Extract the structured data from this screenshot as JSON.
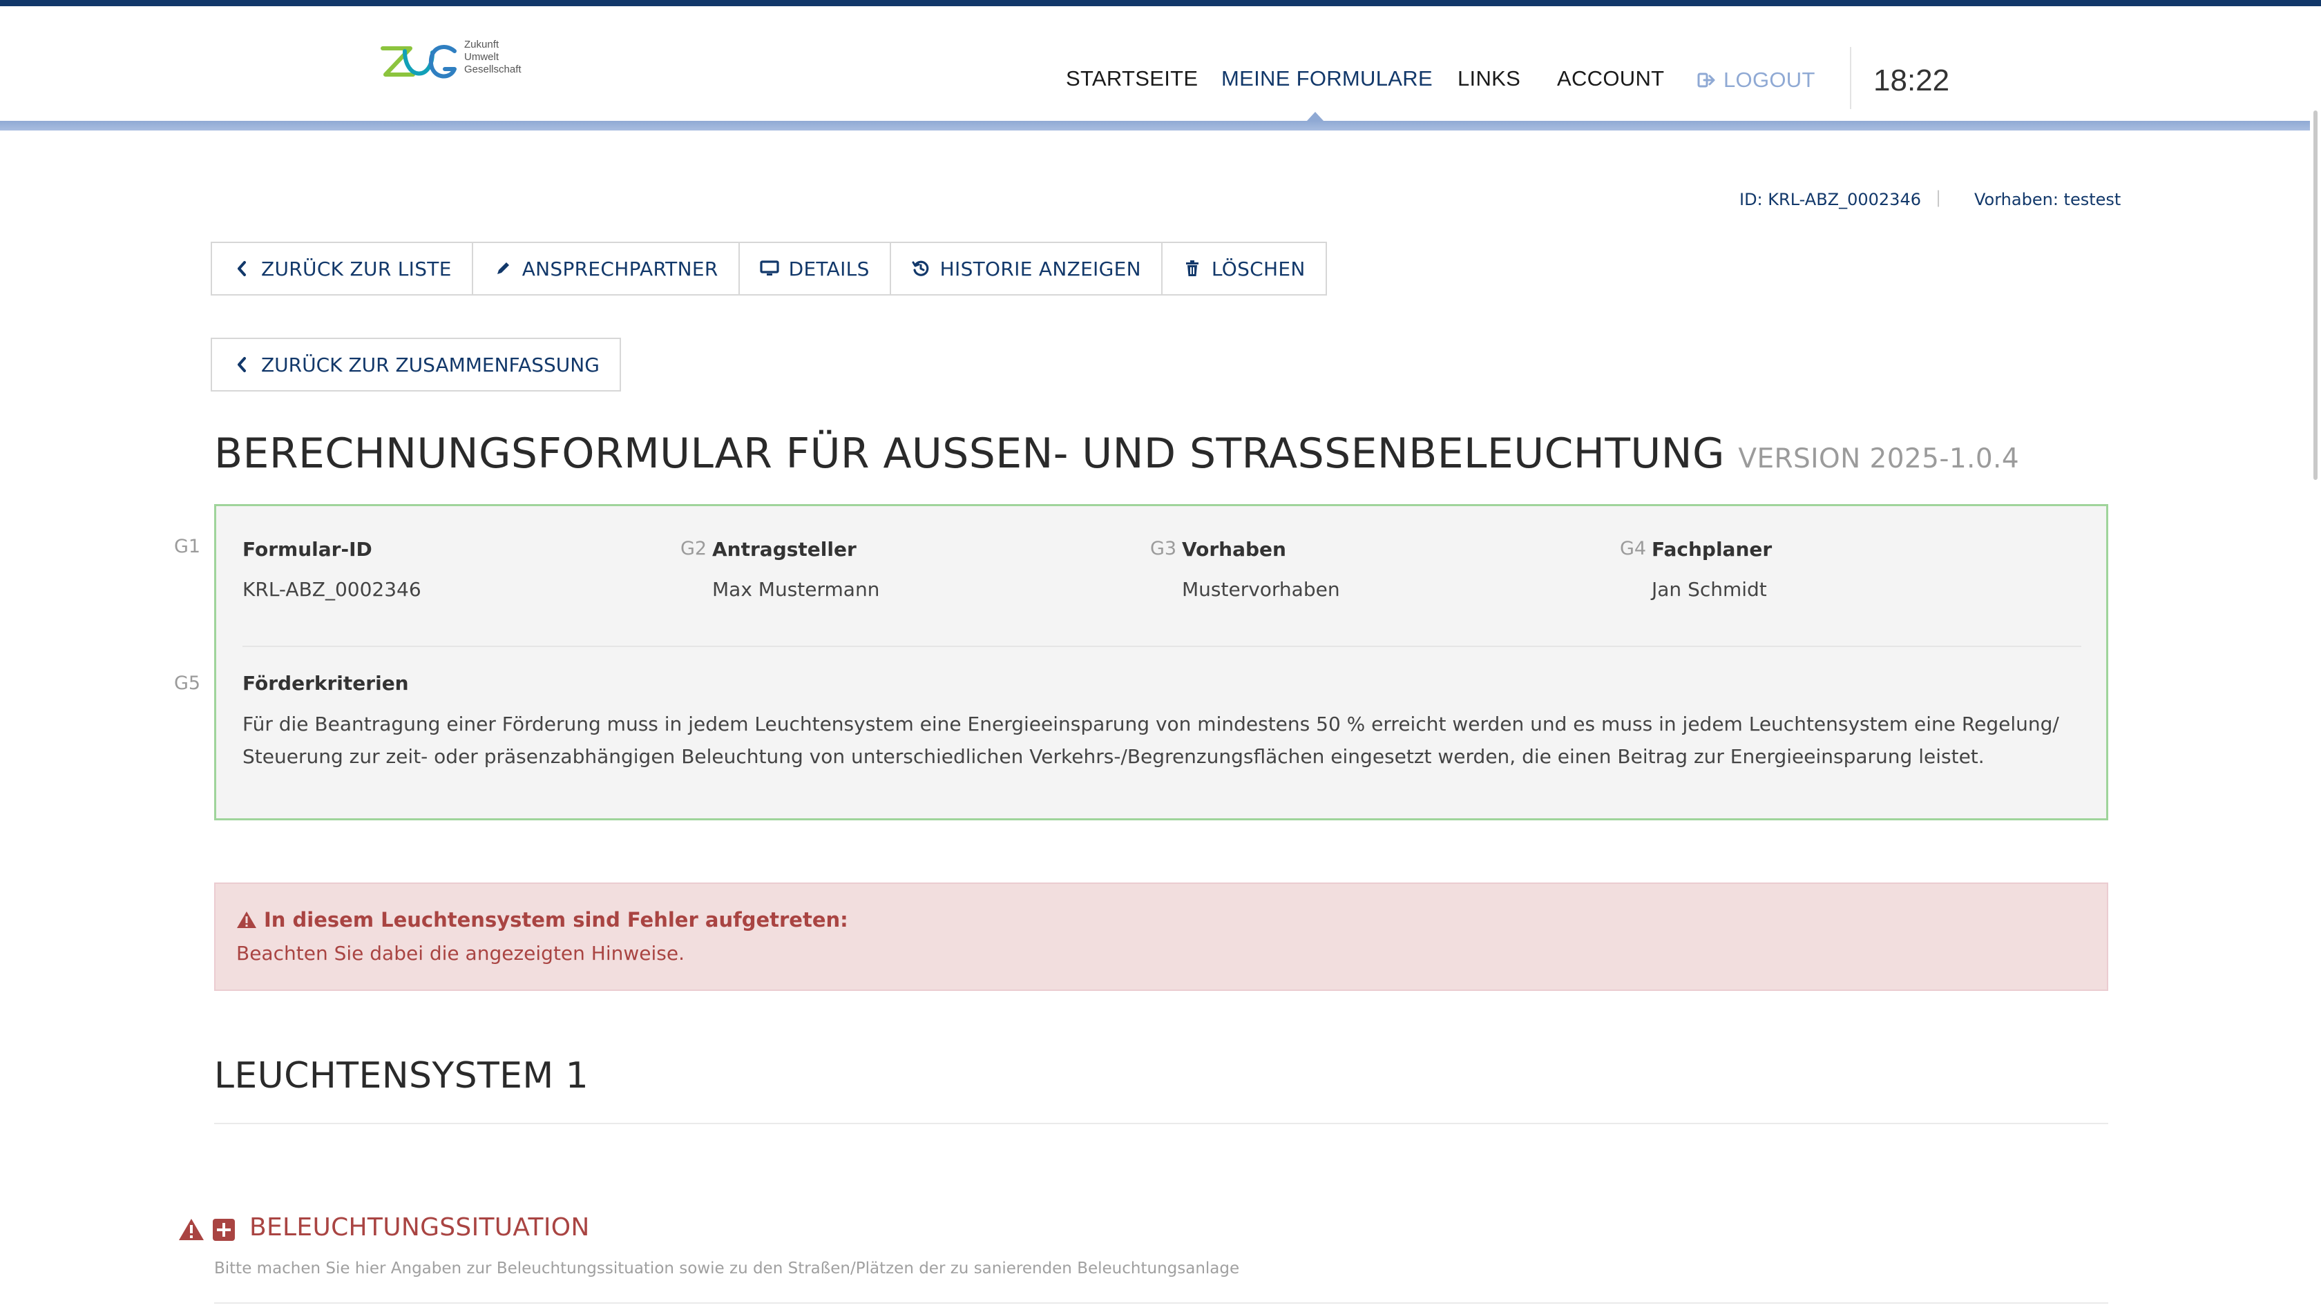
{
  "colors": {
    "brand": "#12386a",
    "nav_accent": "#8fa9d4",
    "info_border": "#9fd49b",
    "error_text": "#a94442",
    "error_bg": "#f2dede"
  },
  "logo": {
    "lines": [
      "Zukunft",
      "Umwelt",
      "Gesellschaft"
    ]
  },
  "nav": {
    "items": [
      {
        "label": "STARTSEITE"
      },
      {
        "label": "MEINE FORMULARE"
      },
      {
        "label": "LINKS"
      },
      {
        "label": "ACCOUNT"
      },
      {
        "label": "LOGOUT"
      }
    ],
    "active": "MEINE FORMULARE",
    "clock": "18:22"
  },
  "meta": {
    "id": "ID: KRL-ABZ_0002346",
    "separator": "|",
    "vorhaben": "Vorhaben: testest"
  },
  "toolbar": {
    "back_to_list": "ZURÜCK ZUR LISTE",
    "contact": "ANSPRECHPARTNER",
    "details": "DETAILS",
    "history": "HISTORIE ANZEIGEN",
    "delete": "LÖSCHEN",
    "back_to_summary": "ZURÜCK ZUR ZUSAMMENFASSUNG"
  },
  "title": {
    "main": "BERECHNUNGSFORMULAR FÜR AUSSEN- UND STRASSENBELEUCHTUNG",
    "version": "VERSION 2025-1.0.4"
  },
  "info": {
    "fields": [
      {
        "code": "G1",
        "label": "Formular-ID",
        "value": "KRL-ABZ_0002346"
      },
      {
        "code": "G2",
        "label": "Antragsteller",
        "value": "Max Mustermann"
      },
      {
        "code": "G3",
        "label": "Vorhaben",
        "value": "Mustervorhaben"
      },
      {
        "code": "G4",
        "label": "Fachplaner",
        "value": "Jan Schmidt"
      }
    ],
    "criteria": {
      "code": "G5",
      "label": "Förderkriterien",
      "text": "Für die Beantragung einer Förderung muss in jedem Leuchtensystem eine Energieeinsparung von mindestens 50 % erreicht werden und es muss in jedem Leuchtensystem eine Regelung/ Steuerung zur zeit- oder präsenzabhängigen Beleuchtung von unterschiedlichen Verkehrs-/Begrenzungsflächen eingesetzt werden, die einen Beitrag zur Energieeinsparung leistet."
    }
  },
  "alert": {
    "title": "In diesem Leuchtensystem sind Fehler aufgetreten:",
    "text": "Beachten Sie dabei die angezeigten Hinweise."
  },
  "section": {
    "title": "LEUCHTENSYSTEM 1",
    "subsection": {
      "title": "BELEUCHTUNGSSITUATION",
      "description": "Bitte machen Sie hier Angaben zur Beleuchtungssituation sowie zu den Straßen/Plätzen der zu sanierenden Beleuchtungsanlage",
      "icons": [
        "warning-icon",
        "plus-square-icon"
      ]
    }
  }
}
